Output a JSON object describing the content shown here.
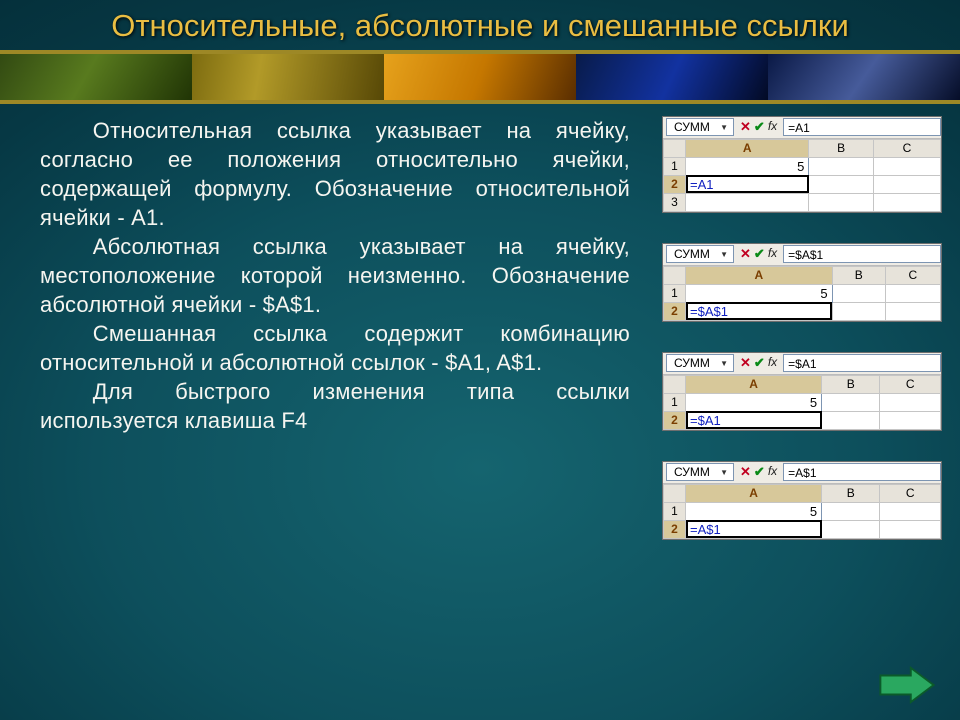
{
  "title": "Относительные, абсолютные и смешанные ссылки",
  "body": {
    "p1": "Относительная ссылка указывает на ячейку, согласно ее положения относительно ячейки, содержащей формулу. Обозначение относительной ячейки - A1.",
    "p2": "Абсолютная ссылка указывает на ячейку, местоположение которой неизменно. Обозначение абсолютной ячейки - $A$1.",
    "p3": "Смешанная ссылка содержит комбинацию относительной и абсолютной ссылок - $A1, A$1.",
    "p4": "Для быстрого изменения типа ссылки используется клавиша F4"
  },
  "excel": {
    "namebox": "СУММ",
    "fx": "fx",
    "cols": {
      "a": "A",
      "b": "B",
      "c": "C"
    },
    "rows": {
      "r1": "1",
      "r2": "2",
      "r3": "3"
    },
    "a1value": "5",
    "ref1": "=A1",
    "barRef1": "=A1",
    "ref2": "=$A$1",
    "barRef2": "=$A$1",
    "ref3": "=$A1",
    "barRef3": "=$A1",
    "ref4": "=A$1",
    "barRef4": "=A$1"
  }
}
